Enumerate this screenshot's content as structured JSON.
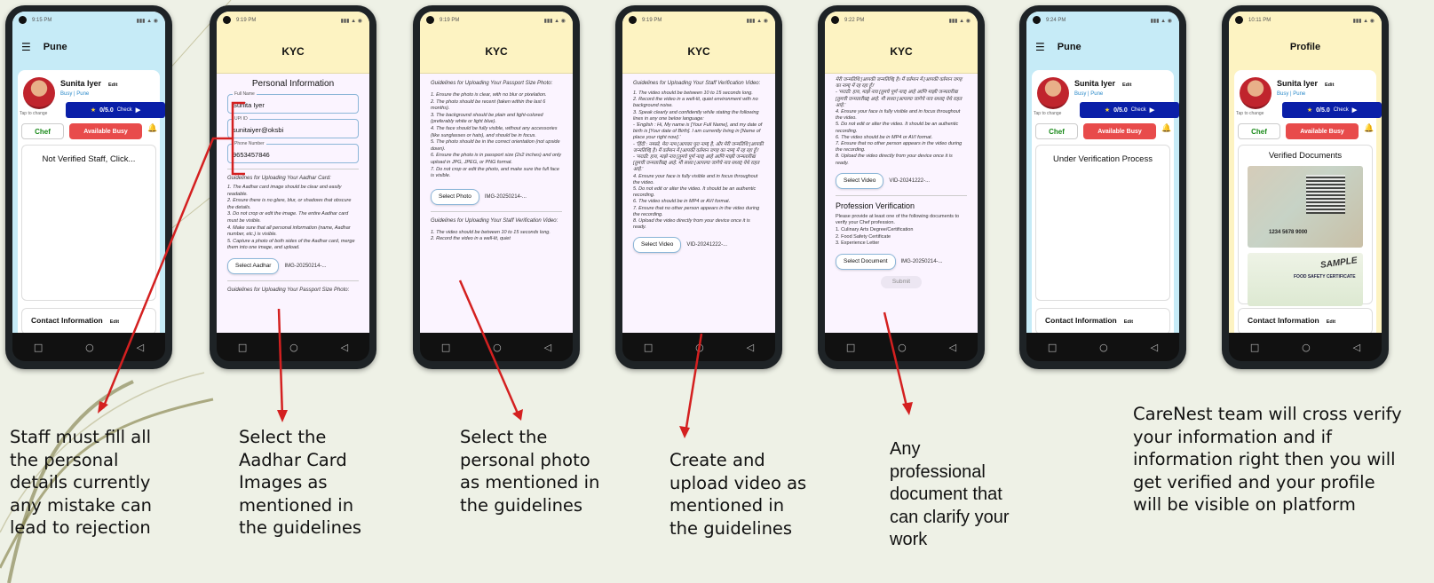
{
  "screens": {
    "s1": {
      "time": "9:15 PM",
      "menu_icon": "menu-icon",
      "city": "Pune",
      "name": "Sunita Iyer",
      "edit": "Edit",
      "status_busy": "Busy",
      "status_city": "Pune",
      "tap_to_change": "Tap to change",
      "rating": "0/5.0",
      "check": "Check",
      "role": "Chef",
      "availability": "Available  Busy",
      "verification_text": "Not Verified Staff, Click...",
      "contact": "Contact Information",
      "contact_edit": "Edit"
    },
    "s2": {
      "time": "9:19 PM",
      "title": "KYC",
      "section": "Personal Information",
      "full_name_label": "Full Name",
      "full_name": "Sunita Iyer",
      "upi_label": "UPI ID",
      "upi": "sunitaiyer@oksbi",
      "phone_label": "Phone Number",
      "phone": "9653457846",
      "guide_title": "Guidelines for Uploading Your Aadhar Card:",
      "guide": [
        "1. The Aadhar card image should be clear and easily readable.",
        "2. Ensure there is no glare, blur, or shadows that obscure the details.",
        "3. Do not crop or edit the image. The entire Aadhar card must be visible.",
        "4. Make sure that all personal information (name, Aadhar number, etc.) is visible.",
        "5. Capture a photo of both sides of the Aadhar card, merge them into one image, and upload."
      ],
      "select_btn": "Select Aadhar",
      "file": "IMG-20250214-...",
      "next_guide": "Guidelines for Uploading Your Passport Size Photo:"
    },
    "s3": {
      "time": "9:19 PM",
      "title": "KYC",
      "guide_title": "Guidelines for Uploading Your Passport Size Photo:",
      "guide": [
        "1. Ensure the photo is clear, with no blur or pixelation.",
        "2. The photo should be recent (taken within the last 6 months).",
        "3. The background should be plain and light-colored (preferably white or light blue).",
        "4. The face should be fully visible, without any accessories (like sunglasses or hats), and should be in focus.",
        "5. The photo should be in the correct orientation (not upside down).",
        "6. Ensure the photo is in passport size (2x2 inches) and only upload in JPG, JPEG, or PNG format.",
        "7. Do not crop or edit the photo, and make sure the full face is visible."
      ],
      "select_btn": "Select Photo",
      "file": "IMG-20250214-...",
      "next_guide": "Guidelines for Uploading Your Staff Verification Video:",
      "next_lines": [
        "1. The video should be between 10 to 15 seconds long.",
        "2. Record the video in a well-lit, quiet"
      ]
    },
    "s4": {
      "time": "9:19 PM",
      "title": "KYC",
      "guide_title": "Guidelines for Uploading Your Staff Verification Video:",
      "guide": [
        "1. The video should be between 10 to 15 seconds long.",
        "2. Record the video in a well-lit, quiet environment with no background noise.",
        "3. Speak clearly and confidently while stating the following lines in any one below language:",
        "  - 'English : Hi, My name is [Your Full Name], and my date of birth is [Your date of Birth]. I am currently living in [Name of place your right now].'",
        "  - 'हिंदी : नमस्ते, मेरा नाम [आपका पूरा नाम] है, और मेरी जन्मतिथि [आपकी जन्मतिथि] है। मैं वर्तमान में [आपकी वर्तमान जगह का नाम] में रह रहा हूँ।'",
        "  - 'मराठी: हाय, माझे नाव [तुमचे पूर्ण नाव] आहे आणि माझी जन्मतारीख [तुमची जन्मतारीख] आहे. मी सध्या [आपल्या जागेचे नाव सध्या] येथे राहत आहे.'",
        "4. Ensure your face is fully visible and in focus throughout the video.",
        "5. Do not edit or alter the video. It should be an authentic recording.",
        "6. The video should be in MP4 or AVI format.",
        "7. Ensure that no other person appears in the video during the recording.",
        "8. Upload the video directly from your device once it is ready."
      ],
      "select_btn": "Select Video",
      "file": "VID-20241222-..."
    },
    "s5": {
      "time": "9:22 PM",
      "title": "KYC",
      "guide": [
        "मेरी जन्मतिथि [आपकी जन्मतिथि] है। मैं वर्तमान में [आपकी वर्तमान जगह का नाम] में रह रहा हूँ।'",
        "  - 'मराठी: हाय, माझे नाव [तुमचे पूर्ण नाव] आहे आणि माझी जन्मतारीख [तुमची जन्मतारीख] आहे. मी सध्या [आपल्या जागेचे नाव सध्या] येथे राहत आहे.'",
        "4. Ensure your face is fully visible and in focus throughout the video.",
        "5. Do not edit or alter the video. It should be an authentic recording.",
        "6. The video should be in MP4 or AVI format.",
        "7. Ensure that no other person appears in the video during the recording.",
        "8. Upload the video directly from your device once it is ready."
      ],
      "video_btn": "Select Video",
      "video_file": "VID-20241222-...",
      "prof_title": "Profession Verification",
      "prof_lines": [
        "Please provide at least one of the following documents to verify your Chef profession.",
        "1. Culinary Arts Degree/Certification",
        "2. Food Safety Certificate",
        "3. Experience Letter"
      ],
      "doc_btn": "Select Document",
      "doc_file": "IMG-20250214-...",
      "submit": "Submit"
    },
    "s6": {
      "time": "9:24 PM",
      "city": "Pune",
      "name": "Sunita Iyer",
      "edit": "Edit",
      "status_busy": "Busy",
      "status_city": "Pune",
      "tap_to_change": "Tap to change",
      "rating": "0/5.0",
      "check": "Check",
      "role": "Chef",
      "availability": "Available  Busy",
      "verification_text": "Under Verification Process",
      "contact": "Contact Information",
      "contact_edit": "Edit"
    },
    "s7": {
      "time": "10:11 PM",
      "title": "Profile",
      "name": "Sunita Iyer",
      "edit": "Edit",
      "status_busy": "Busy",
      "status_city": "Pune",
      "tap_to_change": "Tap to change",
      "rating": "0/5.0",
      "check": "Check",
      "role": "Chef",
      "availability": "Available  Busy",
      "docs_title": "Verified Documents",
      "doc1_number": "1234 5678 9000",
      "doc2_sample": "SAMPLE",
      "doc2_cert": "FOOD SAFETY CERTIFICATE",
      "contact": "Contact Information",
      "contact_edit": "Edit"
    }
  },
  "captions": {
    "c1": "Staff must fill all the personal details currently any mistake can lead to rejection",
    "c2": "Select the Aadhar Card Images as mentioned in the guidelines",
    "c3": "Select the personal photo as mentioned in the guidelines",
    "c4": "Create and upload video as mentioned in the guidelines",
    "c5": "Any professional document that can clarify your work",
    "c6": "CareNest team will cross verify your information and if information right then you will get verified and your profile will be visible on platform"
  },
  "colors": {
    "background": "#eef1e6",
    "header_blue": "#c6ebf7",
    "header_yellow": "#fdf3c2",
    "rating_blue": "#0a1fa8",
    "busy_red": "#e84b4b",
    "chef_green": "#1a8a1a",
    "arrow_red": "#d42020"
  },
  "nav_icons": [
    "recent-apps-icon",
    "home-icon",
    "back-icon"
  ]
}
